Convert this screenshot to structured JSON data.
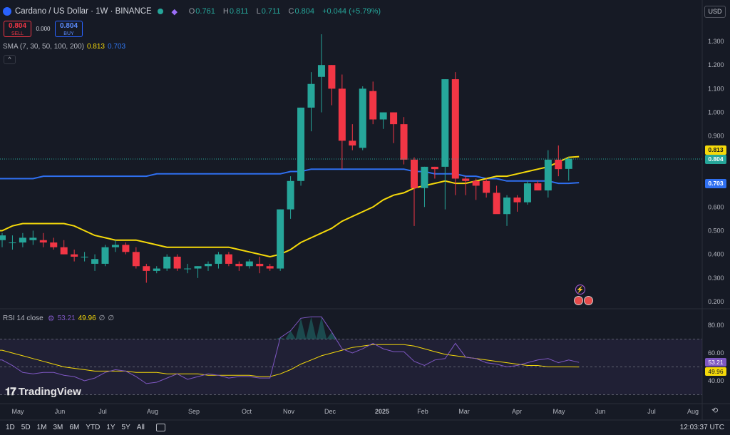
{
  "header": {
    "title": "Cardano / US Dollar · 1W · BINANCE",
    "ohlc": {
      "o_label": "O",
      "o": "0.761",
      "h_label": "H",
      "h": "0.811",
      "l_label": "L",
      "l": "0.711",
      "c_label": "C",
      "c": "0.804",
      "change": "+0.044 (+5.79%)"
    },
    "colors": {
      "up": "#26a69a",
      "down": "#f23645"
    }
  },
  "trade": {
    "sell_value": "0.804",
    "sell_label": "SELL",
    "spread": "0.000",
    "buy_value": "0.804",
    "buy_label": "BUY"
  },
  "sma_legend": {
    "text": "SMA (7, 30, 50, 100, 200)",
    "v1": "0.813",
    "v2": "0.703"
  },
  "rsi_legend": {
    "text": "RSI 14 close",
    "v1": "53.21",
    "v2": "49.96",
    "n1": "∅",
    "n2": "∅"
  },
  "currency_button": "USD",
  "price_axis": {
    "labels": [
      "1.300",
      "1.200",
      "1.100",
      "1.000",
      "0.900",
      "0.800",
      "0.700",
      "0.600",
      "0.500",
      "0.400",
      "0.300",
      "0.200"
    ],
    "tags": {
      "sma_fast": "0.813",
      "last": "0.804",
      "sma_slow": "0.703"
    }
  },
  "rsi_axis": {
    "labels": [
      "80.00",
      "60.00",
      "40.00"
    ],
    "tags": {
      "rsi": "53.21",
      "rsi_ma": "49.96"
    }
  },
  "time_axis": {
    "labels": [
      "May",
      "Jun",
      "Jul",
      "Aug",
      "Sep",
      "Oct",
      "Nov",
      "Dec",
      "2025",
      "Feb",
      "Mar",
      "Apr",
      "May",
      "Jun",
      "Jul",
      "Aug"
    ]
  },
  "watermark": "TradingView",
  "bottom_bar": {
    "timeframes": [
      "1D",
      "5D",
      "1M",
      "3M",
      "6M",
      "YTD",
      "1Y",
      "5Y",
      "All"
    ],
    "clock": "12:03:37 UTC"
  },
  "chart_data": {
    "type": "candlestick",
    "title": "Cardano / US Dollar · 1W · BINANCE",
    "price_range": [
      0.18,
      1.36
    ],
    "candles": [
      {
        "o": 0.46,
        "h": 0.49,
        "l": 0.43,
        "c": 0.48
      },
      {
        "o": 0.45,
        "h": 0.48,
        "l": 0.42,
        "c": 0.45
      },
      {
        "o": 0.45,
        "h": 0.49,
        "l": 0.43,
        "c": 0.47
      },
      {
        "o": 0.46,
        "h": 0.5,
        "l": 0.44,
        "c": 0.47
      },
      {
        "o": 0.46,
        "h": 0.49,
        "l": 0.43,
        "c": 0.45
      },
      {
        "o": 0.45,
        "h": 0.47,
        "l": 0.42,
        "c": 0.43
      },
      {
        "o": 0.43,
        "h": 0.46,
        "l": 0.4,
        "c": 0.4
      },
      {
        "o": 0.4,
        "h": 0.42,
        "l": 0.37,
        "c": 0.39
      },
      {
        "o": 0.39,
        "h": 0.41,
        "l": 0.37,
        "c": 0.39
      },
      {
        "o": 0.36,
        "h": 0.4,
        "l": 0.33,
        "c": 0.38
      },
      {
        "o": 0.36,
        "h": 0.44,
        "l": 0.35,
        "c": 0.43
      },
      {
        "o": 0.43,
        "h": 0.46,
        "l": 0.41,
        "c": 0.44
      },
      {
        "o": 0.44,
        "h": 0.45,
        "l": 0.4,
        "c": 0.41
      },
      {
        "o": 0.41,
        "h": 0.43,
        "l": 0.34,
        "c": 0.35
      },
      {
        "o": 0.35,
        "h": 0.36,
        "l": 0.28,
        "c": 0.33
      },
      {
        "o": 0.33,
        "h": 0.35,
        "l": 0.32,
        "c": 0.34
      },
      {
        "o": 0.34,
        "h": 0.4,
        "l": 0.33,
        "c": 0.39
      },
      {
        "o": 0.39,
        "h": 0.4,
        "l": 0.33,
        "c": 0.34
      },
      {
        "o": 0.34,
        "h": 0.36,
        "l": 0.32,
        "c": 0.34
      },
      {
        "o": 0.34,
        "h": 0.35,
        "l": 0.3,
        "c": 0.35
      },
      {
        "o": 0.35,
        "h": 0.37,
        "l": 0.33,
        "c": 0.36
      },
      {
        "o": 0.36,
        "h": 0.41,
        "l": 0.34,
        "c": 0.4
      },
      {
        "o": 0.4,
        "h": 0.41,
        "l": 0.35,
        "c": 0.36
      },
      {
        "o": 0.36,
        "h": 0.37,
        "l": 0.33,
        "c": 0.35
      },
      {
        "o": 0.35,
        "h": 0.38,
        "l": 0.34,
        "c": 0.37
      },
      {
        "o": 0.36,
        "h": 0.39,
        "l": 0.32,
        "c": 0.35
      },
      {
        "o": 0.35,
        "h": 0.36,
        "l": 0.33,
        "c": 0.34
      },
      {
        "o": 0.34,
        "h": 0.59,
        "l": 0.33,
        "c": 0.59
      },
      {
        "o": 0.59,
        "h": 0.73,
        "l": 0.55,
        "c": 0.71
      },
      {
        "o": 0.71,
        "h": 1.02,
        "l": 0.69,
        "c": 1.02
      },
      {
        "o": 1.02,
        "h": 1.17,
        "l": 0.92,
        "c": 1.12
      },
      {
        "o": 1.15,
        "h": 1.33,
        "l": 1.0,
        "c": 1.2
      },
      {
        "o": 1.2,
        "h": 1.2,
        "l": 1.03,
        "c": 1.1
      },
      {
        "o": 1.1,
        "h": 1.16,
        "l": 0.76,
        "c": 0.88
      },
      {
        "o": 0.88,
        "h": 0.95,
        "l": 0.84,
        "c": 0.86
      },
      {
        "o": 0.85,
        "h": 1.11,
        "l": 0.84,
        "c": 1.1
      },
      {
        "o": 1.09,
        "h": 1.13,
        "l": 0.95,
        "c": 0.97
      },
      {
        "o": 0.97,
        "h": 1.0,
        "l": 0.93,
        "c": 1.0
      },
      {
        "o": 1.0,
        "h": 1.0,
        "l": 0.87,
        "c": 0.95
      },
      {
        "o": 0.95,
        "h": 0.98,
        "l": 0.78,
        "c": 0.8
      },
      {
        "o": 0.8,
        "h": 0.81,
        "l": 0.52,
        "c": 0.68
      },
      {
        "o": 0.68,
        "h": 0.77,
        "l": 0.6,
        "c": 0.77
      },
      {
        "o": 0.77,
        "h": 0.77,
        "l": 0.72,
        "c": 0.76
      },
      {
        "o": 0.77,
        "h": 1.14,
        "l": 0.59,
        "c": 1.14
      },
      {
        "o": 1.14,
        "h": 1.17,
        "l": 0.65,
        "c": 0.72
      },
      {
        "o": 0.72,
        "h": 0.73,
        "l": 0.65,
        "c": 0.71
      },
      {
        "o": 0.71,
        "h": 0.72,
        "l": 0.63,
        "c": 0.69
      },
      {
        "o": 0.71,
        "h": 0.72,
        "l": 0.64,
        "c": 0.66
      },
      {
        "o": 0.66,
        "h": 0.69,
        "l": 0.6,
        "c": 0.57
      },
      {
        "o": 0.57,
        "h": 0.65,
        "l": 0.52,
        "c": 0.64
      },
      {
        "o": 0.64,
        "h": 0.65,
        "l": 0.58,
        "c": 0.62
      },
      {
        "o": 0.62,
        "h": 0.71,
        "l": 0.61,
        "c": 0.7
      },
      {
        "o": 0.7,
        "h": 0.71,
        "l": 0.67,
        "c": 0.67
      },
      {
        "o": 0.67,
        "h": 0.84,
        "l": 0.64,
        "c": 0.8
      },
      {
        "o": 0.8,
        "h": 0.86,
        "l": 0.73,
        "c": 0.76
      },
      {
        "o": 0.761,
        "h": 0.811,
        "l": 0.711,
        "c": 0.804
      }
    ],
    "sma_fast": [
      0.5,
      0.52,
      0.53,
      0.53,
      0.53,
      0.53,
      0.53,
      0.52,
      0.5,
      0.48,
      0.47,
      0.46,
      0.46,
      0.46,
      0.45,
      0.44,
      0.43,
      0.43,
      0.43,
      0.43,
      0.43,
      0.43,
      0.43,
      0.42,
      0.41,
      0.4,
      0.39,
      0.4,
      0.42,
      0.45,
      0.47,
      0.49,
      0.51,
      0.54,
      0.56,
      0.58,
      0.6,
      0.63,
      0.65,
      0.66,
      0.68,
      0.69,
      0.7,
      0.71,
      0.7,
      0.7,
      0.71,
      0.72,
      0.73,
      0.73,
      0.74,
      0.75,
      0.76,
      0.77,
      0.79,
      0.81,
      0.813
    ],
    "sma_slow": [
      0.72,
      0.72,
      0.72,
      0.72,
      0.73,
      0.73,
      0.73,
      0.73,
      0.73,
      0.73,
      0.73,
      0.73,
      0.73,
      0.73,
      0.73,
      0.74,
      0.74,
      0.74,
      0.74,
      0.74,
      0.74,
      0.74,
      0.74,
      0.74,
      0.74,
      0.74,
      0.74,
      0.74,
      0.75,
      0.75,
      0.76,
      0.76,
      0.76,
      0.76,
      0.76,
      0.76,
      0.76,
      0.76,
      0.76,
      0.76,
      0.75,
      0.75,
      0.74,
      0.74,
      0.74,
      0.73,
      0.73,
      0.72,
      0.72,
      0.71,
      0.71,
      0.71,
      0.71,
      0.71,
      0.7,
      0.7,
      0.703
    ],
    "rsi": [
      55,
      51,
      46,
      45,
      46,
      46,
      44,
      43,
      40,
      42,
      46,
      48,
      47,
      43,
      38,
      39,
      42,
      45,
      41,
      43,
      45,
      44,
      42,
      43,
      43,
      42,
      42,
      71,
      76,
      85,
      86,
      86,
      75,
      63,
      60,
      63,
      67,
      63,
      61,
      61,
      54,
      51,
      55,
      56,
      67,
      57,
      56,
      53,
      52,
      50,
      51,
      53,
      55,
      56,
      53,
      55,
      53.21
    ],
    "rsi_ma": [
      62,
      60,
      58,
      56,
      54,
      52,
      50,
      49,
      48,
      47,
      47,
      47,
      47,
      46,
      46,
      46,
      45,
      45,
      45,
      45,
      44,
      44,
      44,
      44,
      44,
      43,
      43,
      45,
      48,
      52,
      55,
      58,
      60,
      62,
      64,
      65,
      66,
      66,
      66,
      66,
      65,
      63,
      61,
      59,
      58,
      57,
      56,
      55,
      54,
      53,
      52,
      51,
      51,
      50,
      50,
      50,
      49.96
    ],
    "rsi_range": [
      20,
      100
    ],
    "rsi_bands": {
      "upper": 70,
      "middle": 50,
      "lower": 30
    },
    "legend": {
      "candle_up": "#26a69a",
      "candle_down": "#f23645",
      "sma_fast_color": "#f5d90a",
      "sma_slow_color": "#2f6ff0",
      "rsi_color": "#7e57c2",
      "rsi_ma_color": "#f5d90a"
    }
  }
}
